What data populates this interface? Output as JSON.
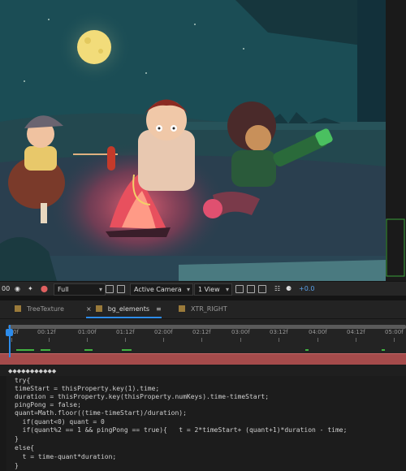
{
  "viewer": {
    "scene": "campfire-illustration"
  },
  "viewer_bar": {
    "zoom_value": "00",
    "resolution": "Full",
    "camera": "Active Camera",
    "view_layout": "1 View",
    "exposure": "+0.0"
  },
  "tabs": [
    {
      "label": "TreeTexture",
      "active": false,
      "swatch": "#9a7a3a"
    },
    {
      "label": "bg_elements",
      "active": true,
      "swatch": "#9a7a3a",
      "close": "×",
      "menu": "≡"
    },
    {
      "label": "XTR_RIGHT",
      "active": false,
      "swatch": "#9a7a3a"
    }
  ],
  "ruler": {
    "labels": [
      "0f",
      "00:12f",
      "01:00f",
      "01:12f",
      "02:00f",
      "02:12f",
      "03:00f",
      "03:12f",
      "04:00f",
      "04:12f",
      "05:00f"
    ]
  },
  "keyframes": "◆◆◆◆◆◆◆◆◆◆◆",
  "expression": [
    "try{",
    "timeStart = thisProperty.key(1).time;",
    "duration = thisProperty.key(thisProperty.numKeys).time-timeStart;",
    "pingPong = false;",
    "quant=Math.floor((time-timeStart)/duration);",
    "  if(quant<0) quant = 0",
    "  if(quant%2 == 1 && pingPong == true){   t = 2*timeStart+ (quant+1)*duration - time;",
    "}",
    "else{",
    "  t = time-quant*duration;",
    "}"
  ],
  "colors": {
    "accent": "#2d8ceb",
    "layer": "#a54b4b",
    "work_area": "#41b441"
  }
}
